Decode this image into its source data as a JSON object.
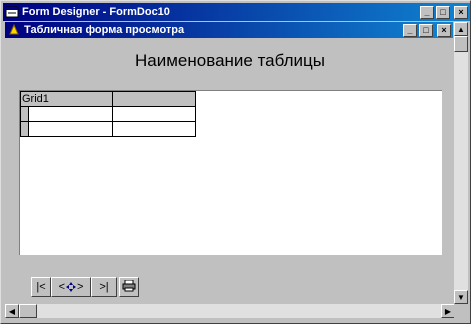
{
  "app_window": {
    "title": "Form Designer - FormDoc10",
    "buttons": [
      "_",
      "□",
      "×"
    ]
  },
  "child_window": {
    "title": "Табличная форма просмотра",
    "buttons": [
      "_",
      "□",
      "×"
    ]
  },
  "form": {
    "heading": "Наименование таблицы",
    "grid": {
      "name": "Grid1",
      "rows": 2
    }
  },
  "navigator": {
    "buttons": [
      "|<",
      "<",
      ">",
      ">|"
    ]
  },
  "colors": {
    "titlebar_start": "#000080",
    "titlebar_end": "#1084d0",
    "window_bg": "#c0c0c0"
  }
}
